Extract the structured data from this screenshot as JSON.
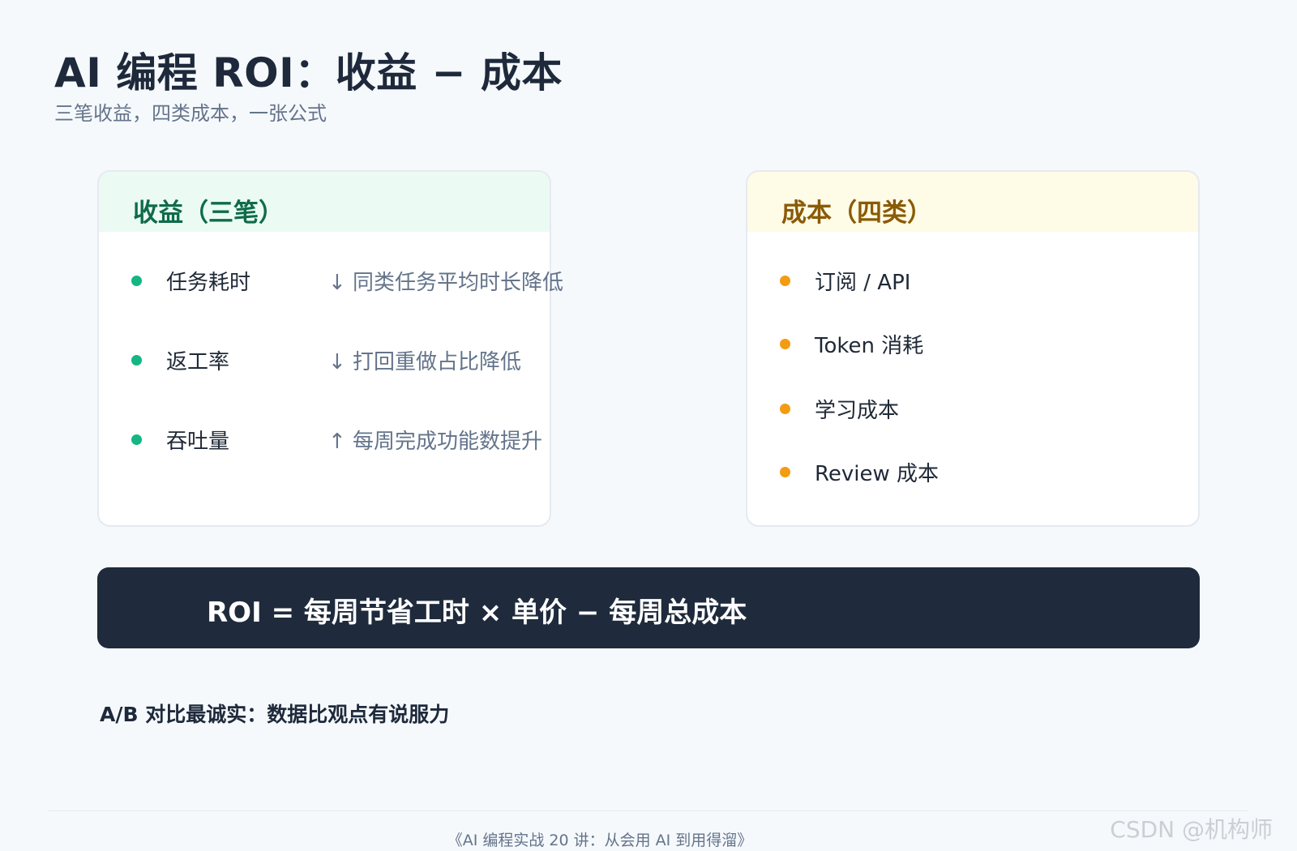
{
  "slide": {
    "title": "AI 编程 ROI：收益 − 成本",
    "subtitle": "三笔收益，四类成本，一张公式"
  },
  "gains": {
    "title": "收益（三笔）",
    "items": [
      {
        "label": "任务耗时",
        "note": "↓ 同类任务平均时长降低"
      },
      {
        "label": "返工率",
        "note": "↓ 打回重做占比降低"
      },
      {
        "label": "吞吐量",
        "note": "↑ 每周完成功能数提升"
      }
    ]
  },
  "costs": {
    "title": "成本（四类）",
    "items": [
      {
        "label": "订阅 / API"
      },
      {
        "label": "Token 消耗"
      },
      {
        "label": "学习成本"
      },
      {
        "label": "Review 成本"
      }
    ]
  },
  "formula": {
    "text": "ROI = 每周节省工时 × 单价 − 每周总成本"
  },
  "ab_note": "A/B 对比最诚实：数据比观点有说服力",
  "footer": "《AI 编程实战 20 讲：从会用 AI 到用得溜》",
  "watermark": "CSDN @机构师",
  "colors": {
    "gains_accent": "#12b783",
    "costs_accent": "#f39c12",
    "formula_bg": "#1f2b3c"
  }
}
